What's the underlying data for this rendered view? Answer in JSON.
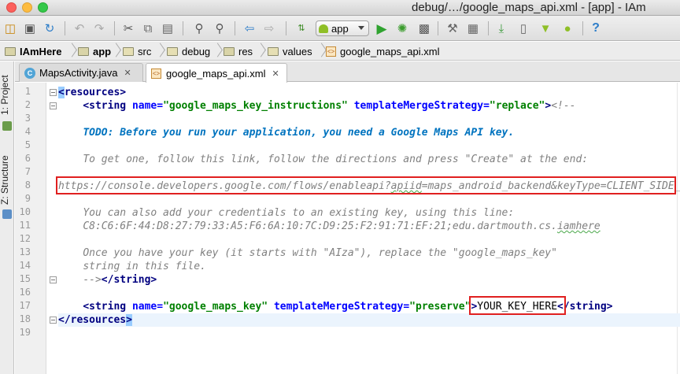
{
  "window": {
    "title": "debug/…/google_maps_api.xml - [app] - IAm"
  },
  "toolbar": {
    "run_config": "app"
  },
  "breadcrumb": {
    "items": [
      "IAmHere",
      "app",
      "src",
      "debug",
      "res",
      "values",
      "google_maps_api.xml"
    ]
  },
  "side": {
    "project_label": "1: Project",
    "structure_label": "Z: Structure"
  },
  "tabs": [
    {
      "label": "MapsActivity.java",
      "icon": "C"
    },
    {
      "label": "google_maps_api.xml",
      "icon": "xml"
    }
  ],
  "editor": {
    "line_numbers": [
      "1",
      "2",
      "3",
      "4",
      "5",
      "6",
      "7",
      "8",
      "9",
      "10",
      "11",
      "12",
      "13",
      "14",
      "15",
      "16",
      "17",
      "18",
      "19"
    ],
    "lines": {
      "l1_open": "<",
      "l1_tag": "resources",
      "l1_close": ">",
      "l2_open": "<",
      "l2_tag": "string",
      "l2_attr1": "name",
      "l2_eq1": "=",
      "l2_val1": "\"google_maps_key_instructions\"",
      "l2_attr2": "templateMergeStrategy",
      "l2_eq2": "=",
      "l2_val2": "\"replace\"",
      "l2_close": ">",
      "l2_comment": "<!--",
      "l4_todo": "TODO: Before you run your application, you need a Google Maps API key.",
      "l6_text": "To get one, follow this link, follow the directions and press \"Create\" at the end:",
      "l8_a": "https://console.developers.google.com/flows/enableapi?",
      "l8_b": "apiid",
      "l8_c": "=maps_android_backend&keyType=CLIENT_SIDE_",
      "l10_text": "You can also add your credentials to an existing key, using this line:",
      "l11_a": "C8:C6:6F:44:D8:27:79:33:A5:F6:6A:10:7C:D9:25:F2:91:71:EF:21;edu.dartmouth.cs.",
      "l11_b": "iamhere",
      "l13_text": "Once you have your key (it starts with \"AIza\"), replace the \"google_maps_key\"",
      "l14_text": "string in this file.",
      "l15_comment": "-->",
      "l15_end": "</string>",
      "l17_open": "<",
      "l17_tag": "string",
      "l17_attr1": "name",
      "l17_eq1": "=",
      "l17_val1": "\"google_maps_key\"",
      "l17_attr2": "templateMergeStrategy",
      "l17_eq2": "=",
      "l17_val2": "\"preserve\"",
      "l17_gt": ">",
      "l17_value": "YOUR_KEY_HERE",
      "l17_end": "</string>",
      "l18_open": "</",
      "l18_tag": "resources",
      "l18_close": ">"
    }
  },
  "colors": {
    "tag": "#000080",
    "attr": "#0000ff",
    "value": "#008000",
    "comment": "#808080",
    "todo": "#0073bf",
    "highlight_box": "#e02020"
  }
}
